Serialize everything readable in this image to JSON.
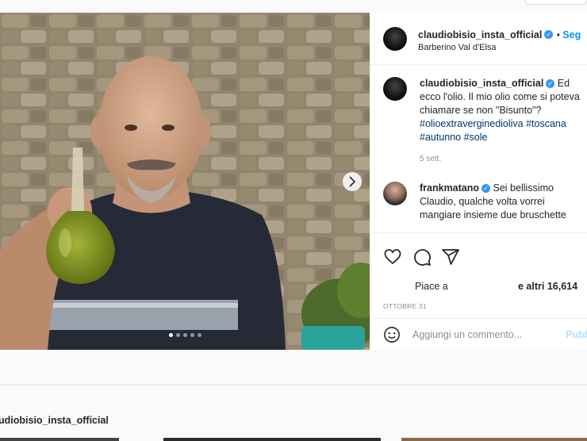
{
  "post": {
    "username": "claudiobisio_insta_official",
    "follow_label": "Seg",
    "location": "Barberino Val d'Elsa",
    "carousel": {
      "dots": 5,
      "active": 0
    }
  },
  "comments": [
    {
      "username": "claudiobisio_insta_official",
      "text_lead": "Ed ecco",
      "text": "l'olio. Il mio olio come si poteva chiamare se non \"Bisunto\"?",
      "tags": "#olioextraverginedioliva #toscana #autunno #sole",
      "time": "5 sett."
    },
    {
      "username": "frankmatano",
      "text_lead": "Sei bellissimo",
      "text": "Claudio, qualche volta vorrei mangiare insieme due bruschette"
    }
  ],
  "likes": {
    "prefix": "Piace a",
    "suffix": "e altri 16,614"
  },
  "date": "OTTOBRE 31",
  "add_comment": {
    "placeholder": "Aggiungi un commento...",
    "publish_label": "Pubb"
  },
  "more_posts": {
    "username_fragment": "udiobisio_insta_official"
  },
  "colors": {
    "accent": "#3897f0",
    "link": "#00376b",
    "muted": "#8e8e8e"
  }
}
